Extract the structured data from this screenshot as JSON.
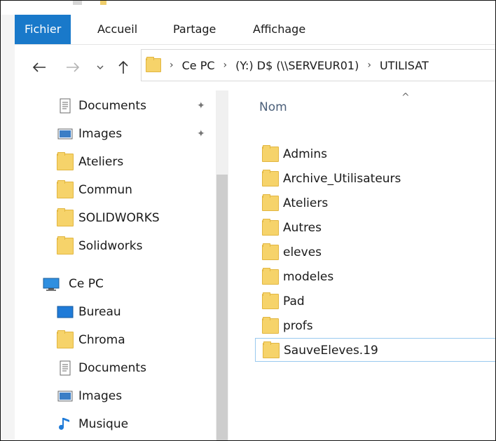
{
  "ribbon": {
    "tabs": [
      {
        "label": "Fichier",
        "active": true
      },
      {
        "label": "Accueil",
        "active": false
      },
      {
        "label": "Partage",
        "active": false
      },
      {
        "label": "Affichage",
        "active": false
      }
    ]
  },
  "address": {
    "crumbs": [
      "Ce PC",
      "(Y:) D$ (\\\\SERVEUR01)",
      "UTILISAT"
    ]
  },
  "nav": {
    "quick_access": [
      {
        "label": "Documents",
        "icon": "documents-icon",
        "pinned": true
      },
      {
        "label": "Images",
        "icon": "images-icon",
        "pinned": true
      },
      {
        "label": "Ateliers",
        "icon": "folder-icon"
      },
      {
        "label": "Commun",
        "icon": "folder-icon"
      },
      {
        "label": "SOLIDWORKS",
        "icon": "folder-icon"
      },
      {
        "label": "Solidworks",
        "icon": "folder-icon"
      }
    ],
    "this_pc": {
      "label": "Ce PC",
      "icon": "computer-icon"
    },
    "this_pc_items": [
      {
        "label": "Bureau",
        "icon": "desktop-icon"
      },
      {
        "label": "Chroma",
        "icon": "folder-icon"
      },
      {
        "label": "Documents",
        "icon": "documents-icon"
      },
      {
        "label": "Images",
        "icon": "images-icon"
      },
      {
        "label": "Musique",
        "icon": "music-icon"
      }
    ]
  },
  "content": {
    "column_header": "Nom",
    "items": [
      "Admins",
      "Archive_Utilisateurs",
      "Ateliers",
      "Autres",
      "eleves",
      "modeles",
      "Pad",
      "profs",
      "SauveEleves.19"
    ],
    "focused_item": "SauveEleves.19"
  },
  "colors": {
    "accent": "#1979ca",
    "folder": "#f6d36a",
    "header_text": "#4c607a"
  }
}
